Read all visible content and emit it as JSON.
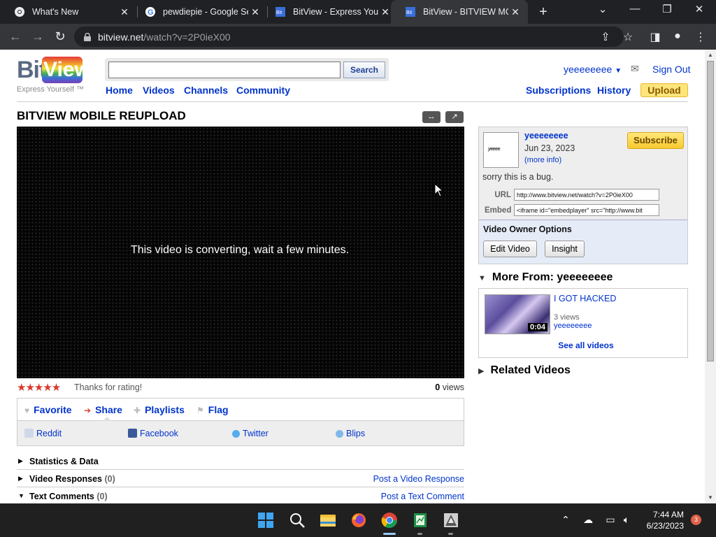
{
  "browser": {
    "tabs": [
      {
        "title": "What's New",
        "active": false
      },
      {
        "title": "pewdiepie - Google Se",
        "active": false
      },
      {
        "title": "BitView - Express Yours",
        "active": false
      },
      {
        "title": "BitView - BITVIEW MOE",
        "active": true
      }
    ],
    "url_host": "bitview.net",
    "url_path": "/watch?v=2P0ieX00"
  },
  "header": {
    "logo_bit": "Bit",
    "logo_view": "View",
    "tagline": "Express Yourself ™",
    "search_button": "Search",
    "search_value": "",
    "nav": [
      "Home",
      "Videos",
      "Channels",
      "Community"
    ],
    "username": "yeeeeeeee",
    "sign_out": "Sign Out",
    "subscriptions": "Subscriptions",
    "history": "History",
    "upload": "Upload"
  },
  "video": {
    "title": "BITVIEW MOBILE REUPLOAD",
    "player_message": "This video is converting, wait a few minutes.",
    "stars": "★★★★★",
    "rating_text": "Thanks for rating!",
    "views_count": "0",
    "views_label": "views"
  },
  "actions": {
    "favorite": "Favorite",
    "share": "Share",
    "playlists": "Playlists",
    "flag": "Flag"
  },
  "share_sites": [
    "Reddit",
    "Facebook",
    "Twitter",
    "Blips"
  ],
  "sections": {
    "statistics": "Statistics & Data",
    "responses": "Video Responses",
    "responses_count": "(0)",
    "post_response": "Post a Video Response",
    "comments": "Text Comments",
    "comments_count": "(0)",
    "post_comment": "Post a Text Comment"
  },
  "uploader": {
    "avatar_text": "yeeee",
    "name": "yeeeeeeee",
    "date": "Jun 23, 2023",
    "more_info": "(more info)",
    "subscribe": "Subscribe",
    "description": "sorry this is a bug.",
    "url_label": "URL",
    "url_value": "http://www.bitview.net/watch?v=2P0ieX00",
    "embed_label": "Embed",
    "embed_value": "<iframe id=\"embedplayer\" src=\"http://www.bit",
    "owner_title": "Video Owner Options",
    "edit_video": "Edit Video",
    "insight": "Insight"
  },
  "more_from": {
    "heading": "More From: yeeeeeeee",
    "video_title": "I GOT HACKED",
    "video_views": "3 views",
    "video_user": "yeeeeeeee",
    "duration": "0:04",
    "see_all": "See all videos"
  },
  "related": {
    "heading": "Related Videos"
  },
  "taskbar": {
    "time": "7:44 AM",
    "date": "6/23/2023",
    "notifications": "3"
  },
  "colors": {
    "link": "#0033cc",
    "upload": "#fde57a",
    "subscribe": "#f8c92f",
    "stars": "#d8392c"
  }
}
